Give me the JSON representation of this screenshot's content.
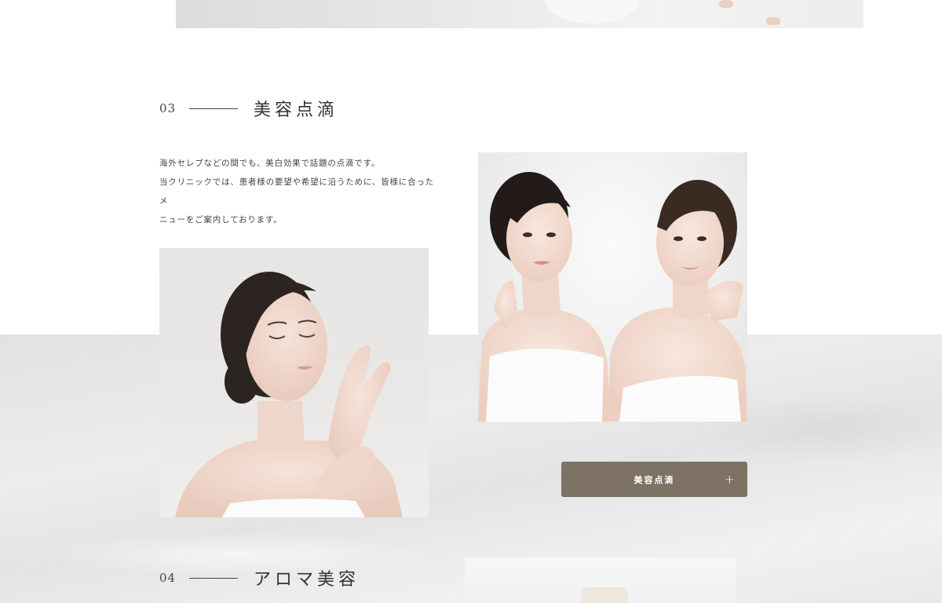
{
  "sections": [
    {
      "number": "03",
      "title": "美容点滴",
      "description_lines": [
        "海外セレブなどの間でも、美白効果で話題の点滴です。",
        "当クリニックでは、患者様の要望や希望に沿うために、皆様に合ったメ",
        "ニューをご案内しております。"
      ],
      "button_label": "美容点滴",
      "button_icon": "plus-icon"
    },
    {
      "number": "04",
      "title": "アロマ美容"
    }
  ],
  "colors": {
    "accent_button": "#7d7263",
    "background_band": "#e6e6e6",
    "text": "#333333"
  },
  "images": {
    "top": "woman-in-white-dress-photo",
    "section3_left": "woman-touching-face-eyes-closed-photo",
    "section3_right": "two-women-back-to-back-photo",
    "section4": "aroma-cream-jar-photo"
  }
}
